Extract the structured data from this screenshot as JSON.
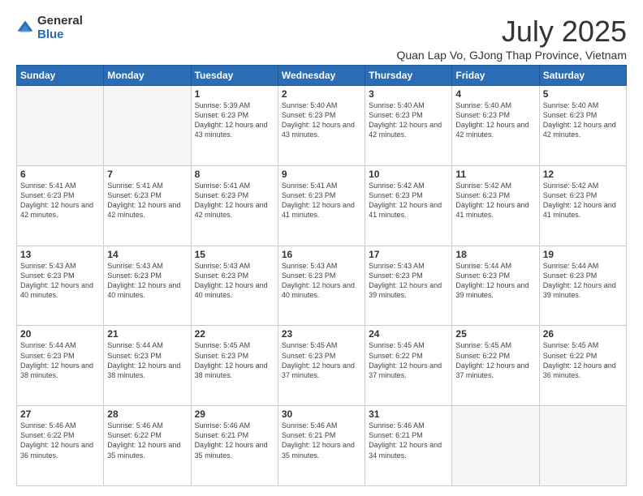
{
  "logo": {
    "general": "General",
    "blue": "Blue"
  },
  "header": {
    "month": "July 2025",
    "location": "Quan Lap Vo, GJong Thap Province, Vietnam"
  },
  "weekdays": [
    "Sunday",
    "Monday",
    "Tuesday",
    "Wednesday",
    "Thursday",
    "Friday",
    "Saturday"
  ],
  "weeks": [
    [
      {
        "day": "",
        "info": ""
      },
      {
        "day": "",
        "info": ""
      },
      {
        "day": "1",
        "info": "Sunrise: 5:39 AM\nSunset: 6:23 PM\nDaylight: 12 hours and 43 minutes."
      },
      {
        "day": "2",
        "info": "Sunrise: 5:40 AM\nSunset: 6:23 PM\nDaylight: 12 hours and 43 minutes."
      },
      {
        "day": "3",
        "info": "Sunrise: 5:40 AM\nSunset: 6:23 PM\nDaylight: 12 hours and 42 minutes."
      },
      {
        "day": "4",
        "info": "Sunrise: 5:40 AM\nSunset: 6:23 PM\nDaylight: 12 hours and 42 minutes."
      },
      {
        "day": "5",
        "info": "Sunrise: 5:40 AM\nSunset: 6:23 PM\nDaylight: 12 hours and 42 minutes."
      }
    ],
    [
      {
        "day": "6",
        "info": "Sunrise: 5:41 AM\nSunset: 6:23 PM\nDaylight: 12 hours and 42 minutes."
      },
      {
        "day": "7",
        "info": "Sunrise: 5:41 AM\nSunset: 6:23 PM\nDaylight: 12 hours and 42 minutes."
      },
      {
        "day": "8",
        "info": "Sunrise: 5:41 AM\nSunset: 6:23 PM\nDaylight: 12 hours and 42 minutes."
      },
      {
        "day": "9",
        "info": "Sunrise: 5:41 AM\nSunset: 6:23 PM\nDaylight: 12 hours and 41 minutes."
      },
      {
        "day": "10",
        "info": "Sunrise: 5:42 AM\nSunset: 6:23 PM\nDaylight: 12 hours and 41 minutes."
      },
      {
        "day": "11",
        "info": "Sunrise: 5:42 AM\nSunset: 6:23 PM\nDaylight: 12 hours and 41 minutes."
      },
      {
        "day": "12",
        "info": "Sunrise: 5:42 AM\nSunset: 6:23 PM\nDaylight: 12 hours and 41 minutes."
      }
    ],
    [
      {
        "day": "13",
        "info": "Sunrise: 5:43 AM\nSunset: 6:23 PM\nDaylight: 12 hours and 40 minutes."
      },
      {
        "day": "14",
        "info": "Sunrise: 5:43 AM\nSunset: 6:23 PM\nDaylight: 12 hours and 40 minutes."
      },
      {
        "day": "15",
        "info": "Sunrise: 5:43 AM\nSunset: 6:23 PM\nDaylight: 12 hours and 40 minutes."
      },
      {
        "day": "16",
        "info": "Sunrise: 5:43 AM\nSunset: 6:23 PM\nDaylight: 12 hours and 40 minutes."
      },
      {
        "day": "17",
        "info": "Sunrise: 5:43 AM\nSunset: 6:23 PM\nDaylight: 12 hours and 39 minutes."
      },
      {
        "day": "18",
        "info": "Sunrise: 5:44 AM\nSunset: 6:23 PM\nDaylight: 12 hours and 39 minutes."
      },
      {
        "day": "19",
        "info": "Sunrise: 5:44 AM\nSunset: 6:23 PM\nDaylight: 12 hours and 39 minutes."
      }
    ],
    [
      {
        "day": "20",
        "info": "Sunrise: 5:44 AM\nSunset: 6:23 PM\nDaylight: 12 hours and 38 minutes."
      },
      {
        "day": "21",
        "info": "Sunrise: 5:44 AM\nSunset: 6:23 PM\nDaylight: 12 hours and 38 minutes."
      },
      {
        "day": "22",
        "info": "Sunrise: 5:45 AM\nSunset: 6:23 PM\nDaylight: 12 hours and 38 minutes."
      },
      {
        "day": "23",
        "info": "Sunrise: 5:45 AM\nSunset: 6:23 PM\nDaylight: 12 hours and 37 minutes."
      },
      {
        "day": "24",
        "info": "Sunrise: 5:45 AM\nSunset: 6:22 PM\nDaylight: 12 hours and 37 minutes."
      },
      {
        "day": "25",
        "info": "Sunrise: 5:45 AM\nSunset: 6:22 PM\nDaylight: 12 hours and 37 minutes."
      },
      {
        "day": "26",
        "info": "Sunrise: 5:45 AM\nSunset: 6:22 PM\nDaylight: 12 hours and 36 minutes."
      }
    ],
    [
      {
        "day": "27",
        "info": "Sunrise: 5:46 AM\nSunset: 6:22 PM\nDaylight: 12 hours and 36 minutes."
      },
      {
        "day": "28",
        "info": "Sunrise: 5:46 AM\nSunset: 6:22 PM\nDaylight: 12 hours and 35 minutes."
      },
      {
        "day": "29",
        "info": "Sunrise: 5:46 AM\nSunset: 6:21 PM\nDaylight: 12 hours and 35 minutes."
      },
      {
        "day": "30",
        "info": "Sunrise: 5:46 AM\nSunset: 6:21 PM\nDaylight: 12 hours and 35 minutes."
      },
      {
        "day": "31",
        "info": "Sunrise: 5:46 AM\nSunset: 6:21 PM\nDaylight: 12 hours and 34 minutes."
      },
      {
        "day": "",
        "info": ""
      },
      {
        "day": "",
        "info": ""
      }
    ]
  ]
}
